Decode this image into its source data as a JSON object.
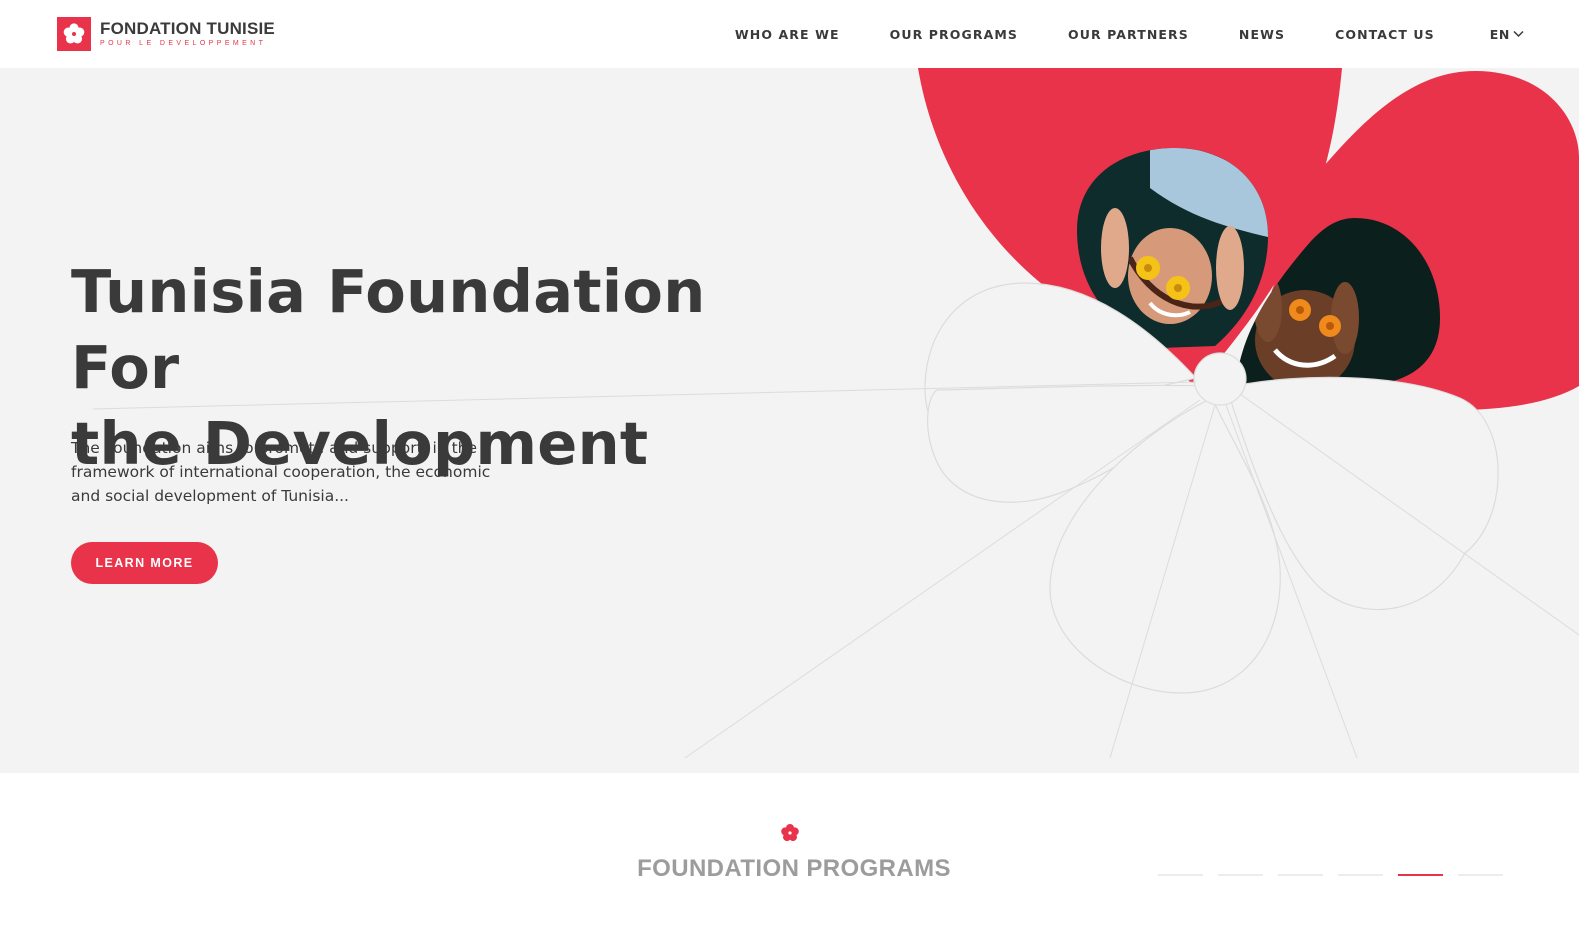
{
  "brand": {
    "name": "FONDATION TUNISIE",
    "tagline": "POUR LE DEVELOPPEMENT",
    "accent_color": "#e8334a",
    "logo_icon": "flower-icon"
  },
  "nav": {
    "items": [
      {
        "label": "WHO ARE WE"
      },
      {
        "label": "OUR PROGRAMS"
      },
      {
        "label": "OUR PARTNERS"
      },
      {
        "label": "NEWS"
      },
      {
        "label": "CONTACT US"
      }
    ],
    "language": {
      "label": "EN",
      "icon": "chevron-down-icon"
    }
  },
  "hero": {
    "title_line1": "Tunisia Foundation For",
    "title_line2": "the Development",
    "description": "The Foundation aims to promote and support, in the framework of international cooperation, the economic and social development of Tunisia...",
    "cta_label": "LEARN MORE",
    "background_color": "#f3f3f3"
  },
  "programs": {
    "title": "FOUNDATION PROGRAMS",
    "icon": "flower-icon",
    "slider": {
      "count": 6,
      "active": 5
    }
  }
}
